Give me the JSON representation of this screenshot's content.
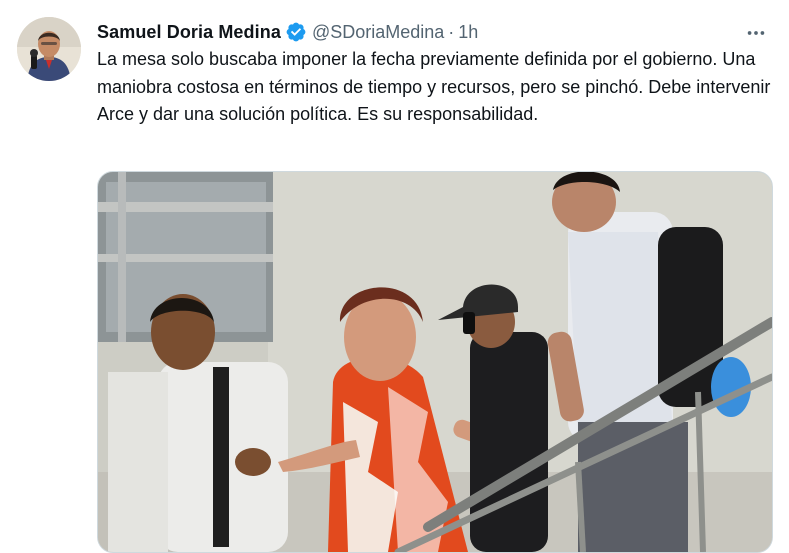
{
  "tweet": {
    "author_name": "Samuel Doria Medina",
    "handle": "@SDoriaMedina",
    "separator": "·",
    "time": "1h",
    "text": "La mesa solo buscaba imponer la fecha previamente definida por el gobierno. Una maniobra costosa en términos de tiempo y recursos, pero se pinchó. Debe intervenir Arce y dar una solución política. Es su responsabilidad.",
    "verified": true,
    "more_icon": "more-horizontal-icon"
  },
  "colors": {
    "verified_blue": "#1d9bf0",
    "secondary_text": "#536471",
    "primary_text": "#0f1419",
    "border": "#cfd9de"
  }
}
